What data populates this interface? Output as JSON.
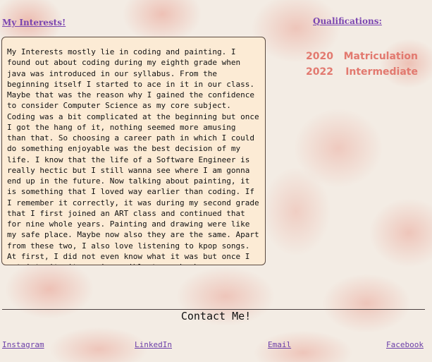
{
  "interests": {
    "heading": "My Interests!",
    "text": "My Interests mostly lie in coding and painting. I\nfound out about coding during my eighth grade when\njava was introduced in our syllabus. From the\nbeginning itself I started to ace in it in our class.\nMaybe that was the reason why I gained the confidence\nto consider Computer Science as my core subject.\nCoding was a bit complicated at the beginning but once\nI got the hang of it, nothing seemed more amusing\nthan that. So choosing a career path in which I could\ndo something enjoyable was the best decision of my\nlife. I know that the life of a Software Engineer is\nreally hectic but I still wanna see where I am gonna\nend up in the future. Now talking about painting, it\nis something that I loved way earlier than coding. If\nI remember it correctly, it was during my second grade\nthat I first joined an ART class and continued that\nfor nine whole years. Painting and drawing were like\nmy safe place. Maybe now also they are the same. Apart\nfrom these two, I also love listening to kpop songs.\nAt first, I did not even know what it was but once I\ngot into it, it was impossible to go back."
  },
  "qualifications": {
    "heading": "Qualifications:",
    "items": [
      {
        "year": "2020",
        "name": "Matriculation"
      },
      {
        "year": "2022",
        "name": "Intermediate"
      }
    ],
    "color": "#e2796f"
  },
  "contact": {
    "title": "Contact Me!",
    "links": {
      "instagram": "Instagram",
      "linkedin": "LinkedIn",
      "email": "Email",
      "facebook": "Facebook"
    }
  },
  "colors": {
    "link": "#7a45b0",
    "box_bg": "#fcebd5"
  }
}
